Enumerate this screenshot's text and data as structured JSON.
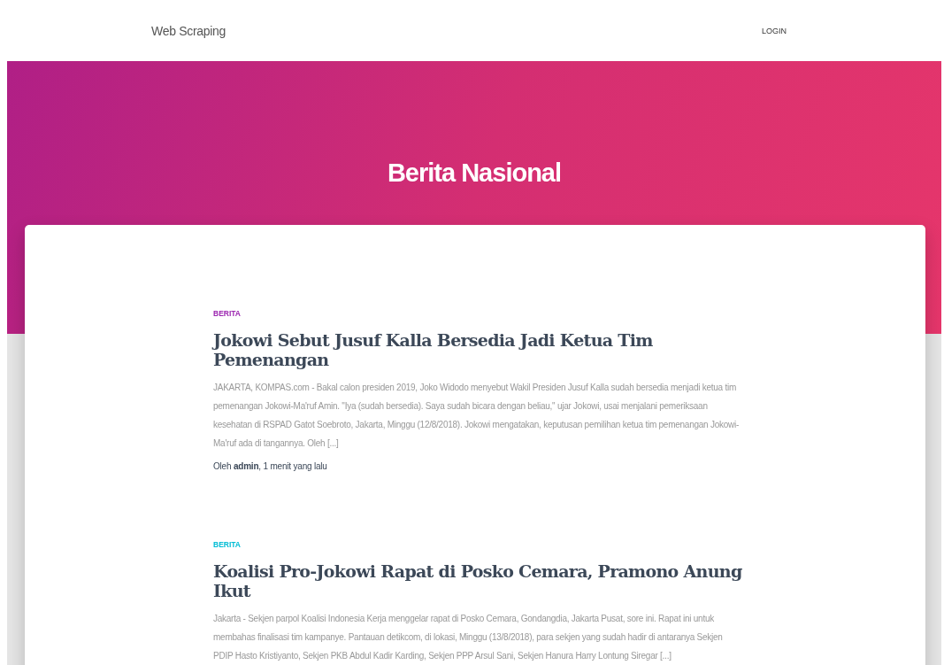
{
  "navbar": {
    "brand": "Web Scraping",
    "login": "LOGIN"
  },
  "hero": {
    "title": "Berita Nasional"
  },
  "posts": [
    {
      "category": "BERITA",
      "color": "#9c27b0",
      "title": "Jokowi Sebut Jusuf Kalla Bersedia Jadi Ketua Tim Pemenangan",
      "excerpt": "JAKARTA, KOMPAS.com - Bakal calon presiden 2019, Joko Widodo menyebut Wakil Presiden Jusuf Kalla sudah bersedia menjadi ketua tim pemenangan Jokowi-Ma'ruf Amin. \"Iya (sudah bersedia). Saya sudah bicara dengan beliau,\" ujar Jokowi, usai menjalani pemeriksaan kesehatan di RSPAD Gatot Soebroto, Jakarta, Minggu (12/8/2018). Jokowi mengatakan, keputusan pemilihan ketua tim pemenangan Jokowi-Ma'ruf ada di tangannya. Oleh [...]",
      "byline": "Oleh **admin**, 1 menit yang lalu"
    },
    {
      "category": "BERITA",
      "color": "#00bcd4",
      "title": "Koalisi Pro-Jokowi Rapat di Posko Cemara, Pramono Anung Ikut",
      "excerpt": "Jakarta - Sekjen parpol Koalisi Indonesia Kerja menggelar rapat di Posko Cemara, Gondangdia, Jakarta Pusat, sore ini. Rapat ini untuk membahas finalisasi tim kampanye. Pantauan detikcom, di lokasi, Minggu (13/8/2018), para sekjen yang sudah hadir di antaranya Sekjen PDIP Hasto Kristiyanto, Sekjen PKB Abdul Kadir Karding, Sekjen PPP Arsul Sani, Sekjen Hanura Harry Lontung Siregar [...]"
    }
  ]
}
